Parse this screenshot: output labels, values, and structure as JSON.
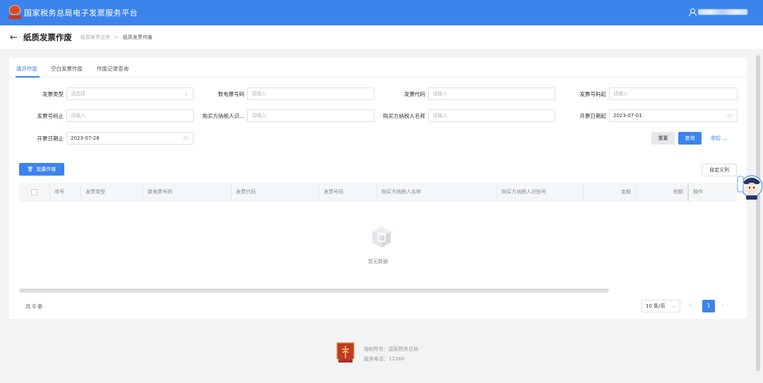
{
  "topbar": {
    "app_title": "国家税务总局电子发票服务平台",
    "user_icon": "user-icon"
  },
  "header": {
    "title": "纸质发票作废",
    "crumbs": [
      "纸质发票业务",
      "纸质发票作废"
    ],
    "sep": ">"
  },
  "tabs": [
    {
      "label": "填开作废",
      "active": true
    },
    {
      "label": "空白发票作废",
      "active": false
    },
    {
      "label": "作废记录查询",
      "active": false
    }
  ],
  "filters": {
    "invoice_type": {
      "label": "发票类型",
      "placeholder": "请选择"
    },
    "e_invoice_no": {
      "label": "数电票号码",
      "placeholder": "请输入"
    },
    "invoice_code": {
      "label": "发票代码",
      "placeholder": "请输入"
    },
    "invoice_no_start": {
      "label": "发票号码起",
      "placeholder": "请输入"
    },
    "invoice_no_end": {
      "label": "发票号码止",
      "placeholder": "请输入"
    },
    "buyer_tax_id": {
      "label": "购买方纳税人识...",
      "placeholder": "请输入"
    },
    "buyer_name": {
      "label": "购买方纳税人名称",
      "placeholder": "请输入"
    },
    "date_start": {
      "label": "开票日期起",
      "value": "2023-07-01"
    },
    "date_end": {
      "label": "开票日期止",
      "value": "2023-07-28"
    }
  },
  "buttons": {
    "reset": "重置",
    "query": "查询",
    "collapse": "收起",
    "batch_void": "批量作废",
    "custom_columns": "自定义列"
  },
  "table": {
    "columns": [
      "序号",
      "发票类型",
      "数电票号码",
      "发票代码",
      "发票号码",
      "购买方纳税人名称",
      "购买方纳税人识别号",
      "金额",
      "税额",
      "操作"
    ],
    "empty_text": "暂无数据"
  },
  "pagination": {
    "total": "共 0 条",
    "page_size": "10 条/页",
    "current_page": "1"
  },
  "footer": {
    "copyright": "版权所有：国家税务总局",
    "phone": "服务电话：12366"
  },
  "colors": {
    "primary": "#3b84ee",
    "topbar": "#3b84ee"
  }
}
